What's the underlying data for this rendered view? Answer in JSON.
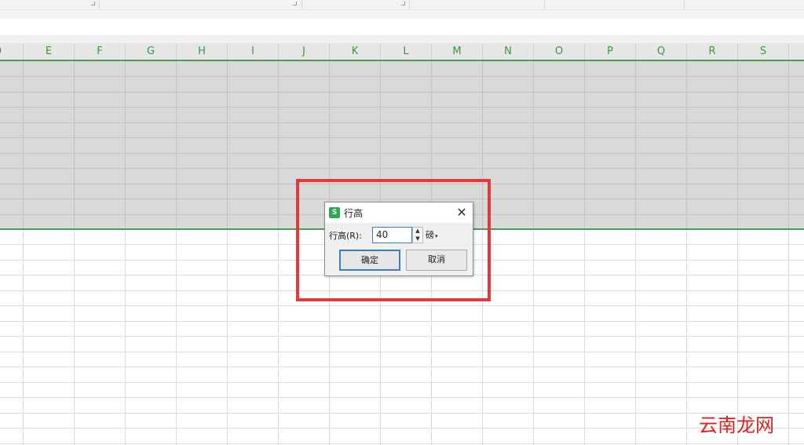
{
  "columns": [
    "D",
    "E",
    "F",
    "G",
    "H",
    "I",
    "J",
    "K",
    "L",
    "M",
    "N",
    "O",
    "P",
    "Q",
    "R",
    "S"
  ],
  "dialog": {
    "app_icon": "S",
    "title": "行高",
    "field_label": "行高(R):",
    "value": "40",
    "unit": "磅",
    "ok_label": "确定",
    "cancel_label": "取消",
    "close_glyph": "✕",
    "spin_up": "▲",
    "spin_down": "▼",
    "unit_arrow": "▾"
  },
  "watermark": "云南龙网",
  "colors": {
    "accent_green": "#4aa04a",
    "header_text_green": "#3a9a3a",
    "selection_gray": "#d9d9d9",
    "highlight_red": "#e8373c",
    "focus_blue": "#3c7fc0"
  }
}
